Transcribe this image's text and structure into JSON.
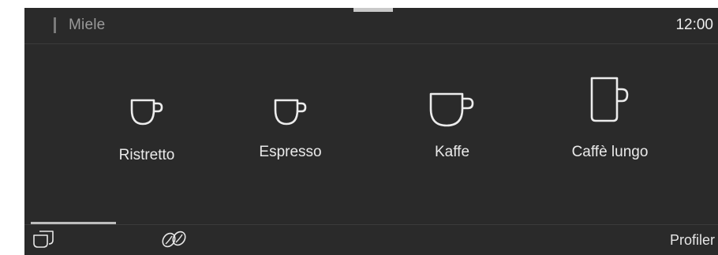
{
  "header": {
    "brand": "Miele",
    "time": "12:00"
  },
  "beverages": [
    {
      "label": "Ristretto",
      "icon": "ristretto-cup-icon"
    },
    {
      "label": "Espresso",
      "icon": "espresso-cup-icon"
    },
    {
      "label": "Kaffe",
      "icon": "coffee-cup-icon"
    },
    {
      "label": "Caffè lungo",
      "icon": "mug-icon"
    }
  ],
  "footer": {
    "left_icon": "cups-icon",
    "middle_icon": "coffee-beans-icon",
    "profiles_label": "Profiler"
  },
  "colors": {
    "screen_background": "#2a2a2a",
    "text": "#eaeaea",
    "muted_text": "#9a9a9a",
    "indicator": "#bdbdbd"
  }
}
